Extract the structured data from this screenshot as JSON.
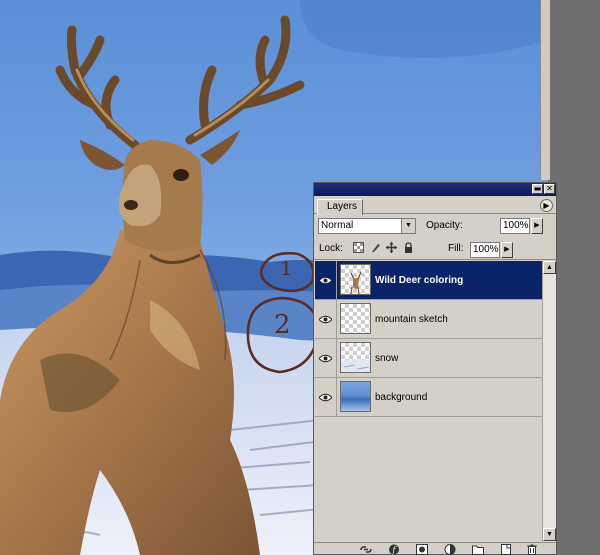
{
  "canvas": {
    "annotations": [
      "1",
      "2"
    ]
  },
  "layers_panel": {
    "tab_label": "Layers",
    "blend_mode": "Normal",
    "opacity_label": "Opacity:",
    "opacity_value": "100%",
    "lock_label": "Lock:",
    "fill_label": "Fill:",
    "fill_value": "100%",
    "layers": [
      {
        "name": "Wild Deer coloring",
        "selected": true,
        "visible": true
      },
      {
        "name": "mountain sketch",
        "selected": false,
        "visible": true
      },
      {
        "name": "snow",
        "selected": false,
        "visible": true
      },
      {
        "name": "background",
        "selected": false,
        "visible": true
      }
    ],
    "icons": [
      "eye-icon",
      "link-icon",
      "layer-style-icon",
      "mask-icon",
      "adjustment-icon",
      "folder-icon",
      "new-layer-icon",
      "trash-icon"
    ]
  },
  "colors": {
    "selection": "#0a246a",
    "panel_bg": "#d4d0c8",
    "titlebar": "#0a1a5c"
  }
}
